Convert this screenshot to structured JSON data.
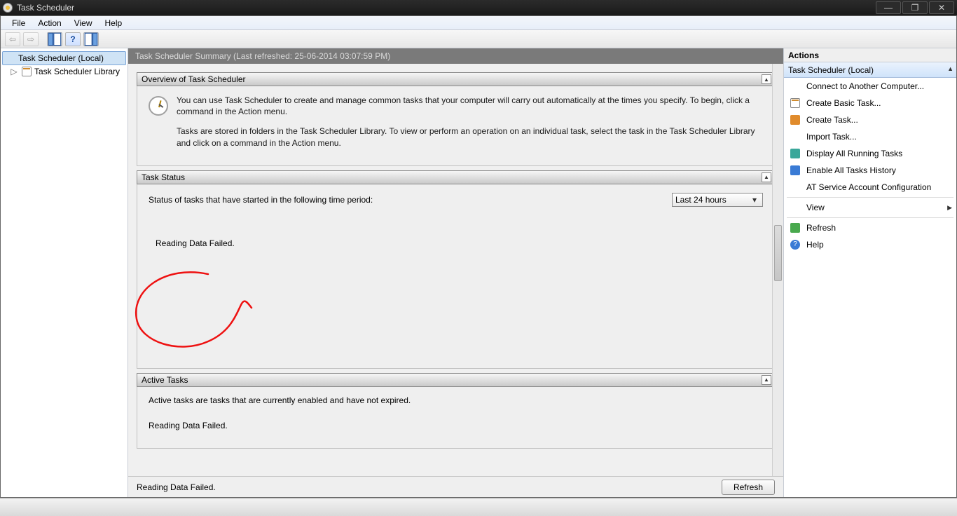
{
  "window": {
    "title": "Task Scheduler"
  },
  "menu": {
    "file": "File",
    "action": "Action",
    "view": "View",
    "help": "Help"
  },
  "tree": {
    "root": "Task Scheduler (Local)",
    "child": "Task Scheduler Library"
  },
  "summary": {
    "bar": "Task Scheduler Summary (Last refreshed: 25-06-2014 03:07:59 PM)"
  },
  "overview": {
    "title": "Overview of Task Scheduler",
    "p1": "You can use Task Scheduler to create and manage common tasks that your computer will carry out automatically at the times you specify. To begin, click a command in the Action menu.",
    "p2": "Tasks are stored in folders in the Task Scheduler Library. To view or perform an operation on an individual task, select the task in the Task Scheduler Library and click on a command in the Action menu."
  },
  "status": {
    "title": "Task Status",
    "label": "Status of tasks that have started in the following time period:",
    "dropdown": "Last 24 hours",
    "message": "Reading Data Failed."
  },
  "active": {
    "title": "Active Tasks",
    "desc": "Active tasks are tasks that are currently enabled and have not expired.",
    "message": "Reading Data Failed."
  },
  "footer": {
    "status": "Reading Data Failed.",
    "refresh": "Refresh"
  },
  "actions": {
    "title": "Actions",
    "group": "Task Scheduler (Local)",
    "items": [
      "Connect to Another Computer...",
      "Create Basic Task...",
      "Create Task...",
      "Import Task...",
      "Display All Running Tasks",
      "Enable All Tasks History",
      "AT Service Account Configuration",
      "View",
      "Refresh",
      "Help"
    ]
  }
}
